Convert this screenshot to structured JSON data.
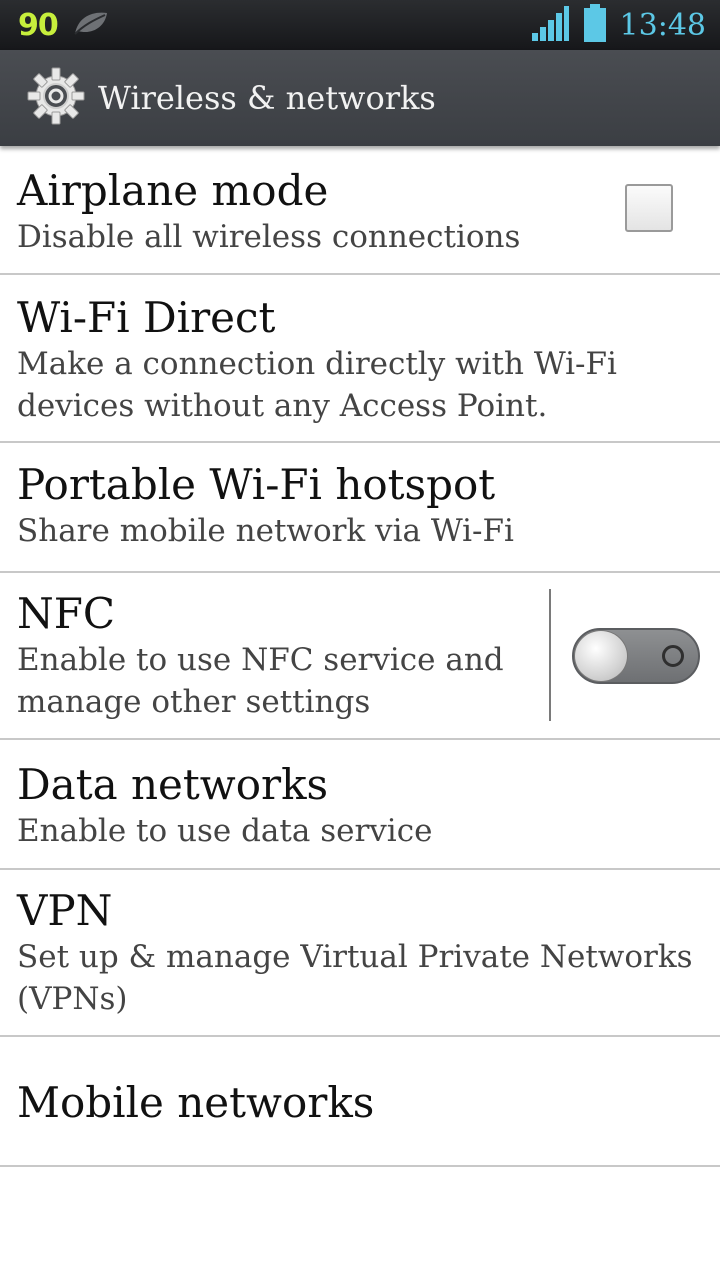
{
  "status_bar": {
    "notification_number": "90",
    "notification_icon": "leaf-icon",
    "signal_icon": "signal-bars-icon",
    "battery_icon": "battery-icon",
    "time": "13:48"
  },
  "action_bar": {
    "icon": "gear-icon",
    "title": "Wireless & networks"
  },
  "items": [
    {
      "title": "Airplane mode",
      "summary": "Disable all wireless connections",
      "control": "checkbox",
      "checked": false
    },
    {
      "title": "Wi-Fi Direct",
      "summary_lines": [
        "Make a connection directly with Wi-Fi",
        "devices without any Access Point."
      ]
    },
    {
      "title": "Portable Wi-Fi hotspot",
      "summary": "Share mobile network via Wi-Fi"
    },
    {
      "title": "NFC",
      "summary_lines": [
        "Enable to use NFC service and",
        "manage other settings"
      ],
      "control": "toggle",
      "on": false
    },
    {
      "title": "Data networks",
      "summary": "Enable to use data service"
    },
    {
      "title": "VPN",
      "summary_lines": [
        "Set up & manage Virtual Private Networks",
        "(VPNs)"
      ]
    },
    {
      "title": "Mobile networks"
    }
  ],
  "colors": {
    "status_bar_bg": "#1e1f22",
    "action_bar_bg": "#43464b",
    "accent_blue": "#5cc8e6",
    "notification_green": "#c7ef3c",
    "divider": "#c8c8c8"
  }
}
